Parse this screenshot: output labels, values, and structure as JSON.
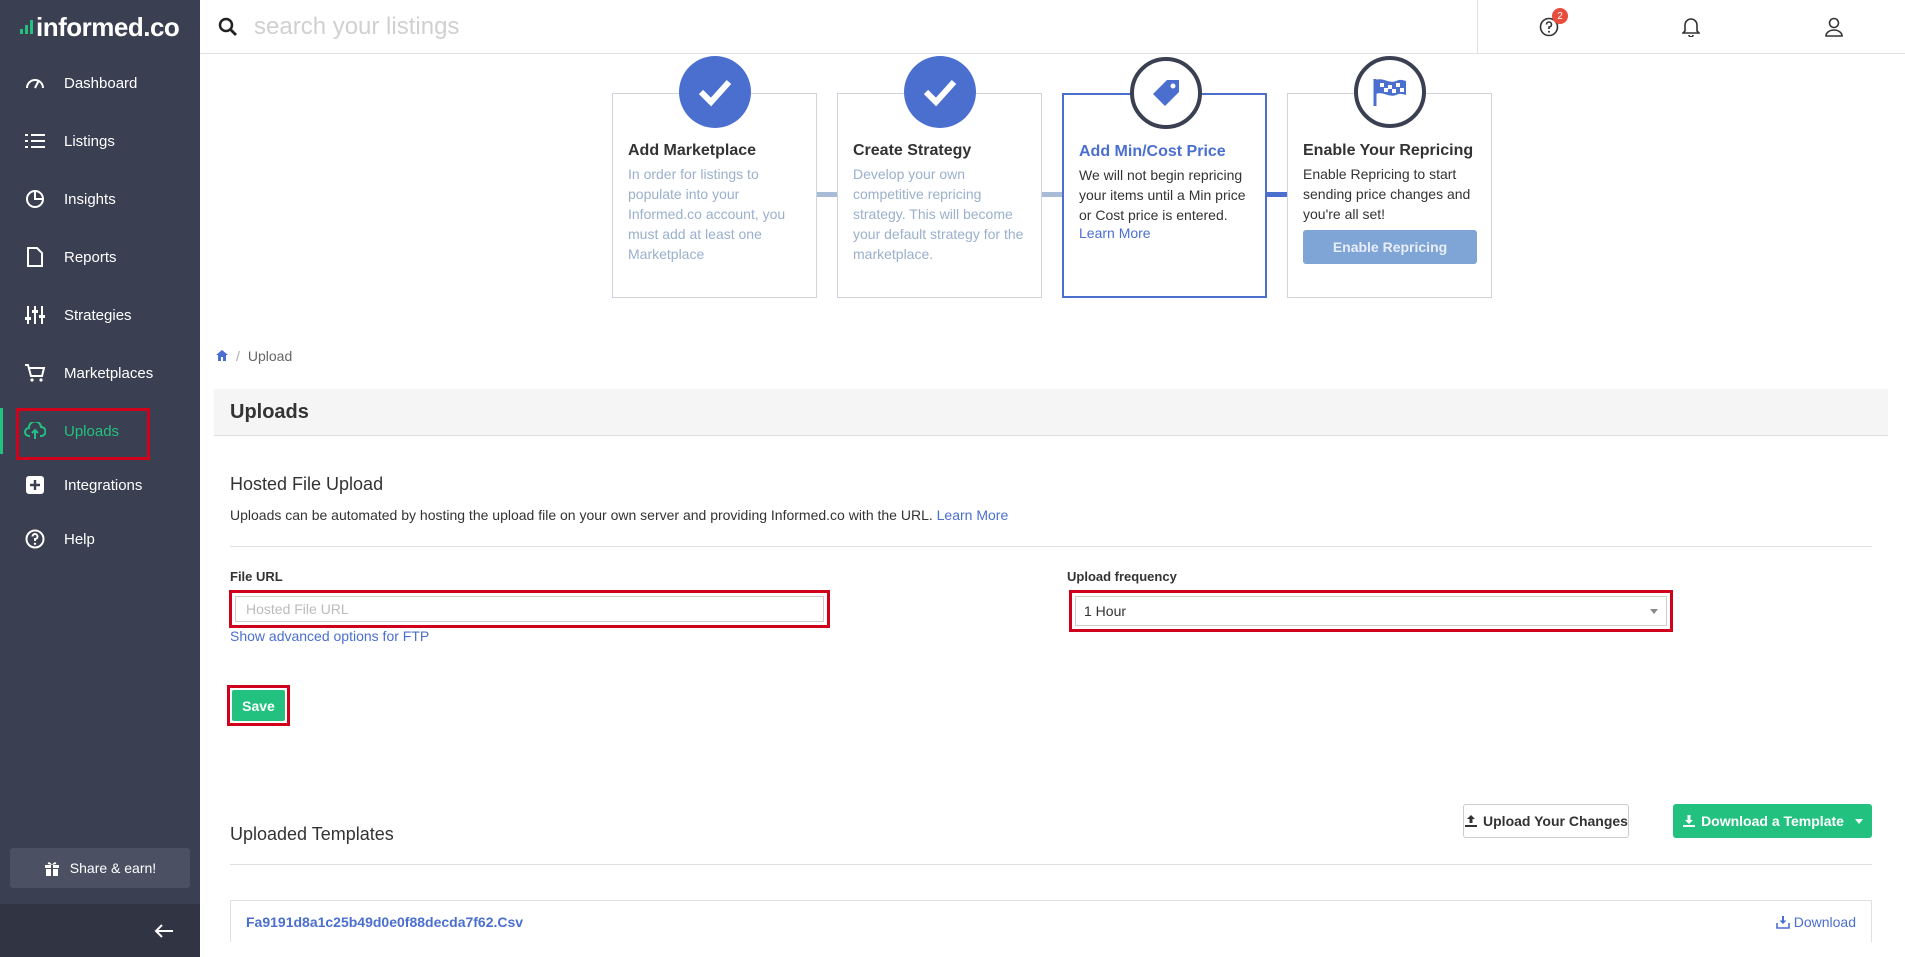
{
  "brand": {
    "name": "informed.co",
    "accent": "#23c17f",
    "sidebar_bg": "#3a3f51",
    "primary": "#4b6fcf",
    "highlight": "#d0021b"
  },
  "sidebar": {
    "items": [
      {
        "label": "Dashboard",
        "icon": "speedometer-icon"
      },
      {
        "label": "Listings",
        "icon": "list-icon"
      },
      {
        "label": "Insights",
        "icon": "pie-chart-icon"
      },
      {
        "label": "Reports",
        "icon": "document-icon"
      },
      {
        "label": "Strategies",
        "icon": "sliders-icon"
      },
      {
        "label": "Marketplaces",
        "icon": "cart-icon"
      },
      {
        "label": "Uploads",
        "icon": "cloud-upload-icon",
        "active": true
      },
      {
        "label": "Integrations",
        "icon": "plus-square-icon"
      },
      {
        "label": "Help",
        "icon": "help-circle-icon"
      }
    ],
    "share_label": "Share & earn!"
  },
  "topbar": {
    "search_placeholder": "search your listings",
    "help_badge": "2"
  },
  "steps": [
    {
      "title": "Add Marketplace",
      "desc": "In order for listings to populate into your Informed.co account, you must add at least one Marketplace",
      "state": "done"
    },
    {
      "title": "Create Strategy",
      "desc": "Develop your own competitive repricing strategy. This will become your default strategy for the marketplace.",
      "state": "done"
    },
    {
      "title": "Add Min/Cost Price",
      "desc": "We will not begin repricing your items until a Min price or Cost price is entered.",
      "link": "Learn More",
      "state": "current"
    },
    {
      "title": "Enable Your Repricing",
      "desc": "Enable Repricing to start sending price changes and you're all set!",
      "button": "Enable Repricing",
      "state": "pending"
    }
  ],
  "breadcrumb": {
    "current": "Upload"
  },
  "page": {
    "title": "Uploads",
    "hosted": {
      "title": "Hosted File Upload",
      "desc": "Uploads can be automated by hosting the upload file on your own server and providing Informed.co with the URL.",
      "learn_more": "Learn More",
      "file_url_label": "File URL",
      "file_url_placeholder": "Hosted File URL",
      "file_url_value": "",
      "frequency_label": "Upload frequency",
      "frequency_value": "1 Hour",
      "advanced_link": "Show advanced options for FTP",
      "save_label": "Save"
    },
    "templates": {
      "title": "Uploaded Templates",
      "upload_label": "Upload Your Changes",
      "download_template_label": "Download a Template",
      "files": [
        {
          "name": "Fa9191d8a1c25b49d0e0f88decda7f62.Csv",
          "action": "Download"
        }
      ]
    }
  }
}
